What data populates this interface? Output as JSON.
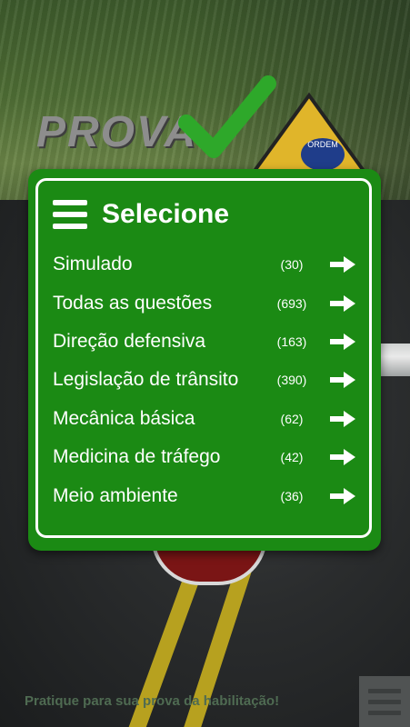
{
  "app": {
    "logo_text": "PROVA"
  },
  "background": {
    "road_sign_text": "ORDEM"
  },
  "panel": {
    "title": "Selecione",
    "accent_color": "#1b8a14",
    "items": [
      {
        "label": "Simulado",
        "count": "(30)",
        "icon": "arrow-right-icon"
      },
      {
        "label": "Todas as questões",
        "count": "(693)",
        "icon": "arrow-right-icon"
      },
      {
        "label": "Direção defensiva",
        "count": "(163)",
        "icon": "arrow-right-icon"
      },
      {
        "label": "Legislação de trânsito",
        "count": "(390)",
        "icon": "arrow-right-icon"
      },
      {
        "label": "Mecânica básica",
        "count": "(62)",
        "icon": "arrow-right-icon"
      },
      {
        "label": "Medicina de tráfego",
        "count": "(42)",
        "icon": "arrow-right-icon"
      },
      {
        "label": "Meio ambiente",
        "count": "(36)",
        "icon": "arrow-right-icon"
      }
    ]
  },
  "footer": {
    "tagline": "Pratique para sua prova da habilitação!",
    "menu_icon": "hamburger-icon"
  }
}
